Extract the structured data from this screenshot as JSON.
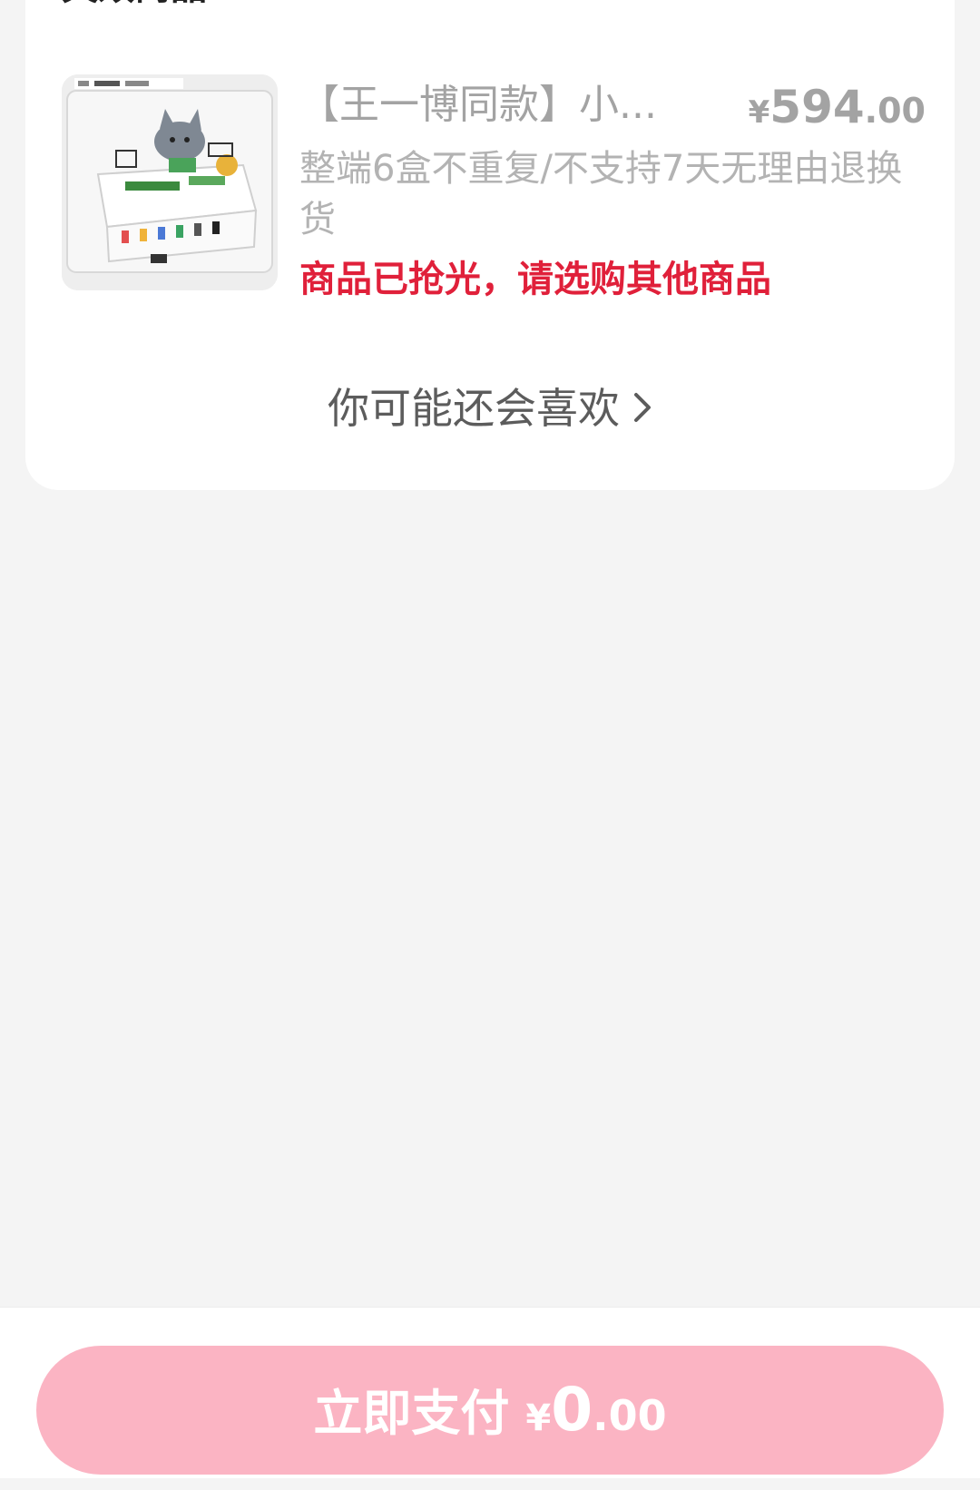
{
  "section": {
    "title": "失效商品"
  },
  "product": {
    "name": "【王一博同款】小...",
    "price_currency": "¥",
    "price_integer": "594",
    "price_decimal": ".00",
    "spec": "整端6盒不重复/不支持7天无理由退换货",
    "status": "商品已抢光，请选购其他商品",
    "image_icon": "product-box-image"
  },
  "recommend": {
    "label": "你可能还会喜欢",
    "icon": "chevron-right-icon"
  },
  "footer": {
    "pay_label": "立即支付",
    "pay_currency": "¥",
    "pay_integer": "0",
    "pay_decimal": ".00"
  },
  "colors": {
    "page_background": "#f4f4f4",
    "card_background": "#ffffff",
    "status_red": "#e0203a",
    "pay_button_pink": "#fbb4c3",
    "muted_gray": "#a3a3a3"
  }
}
